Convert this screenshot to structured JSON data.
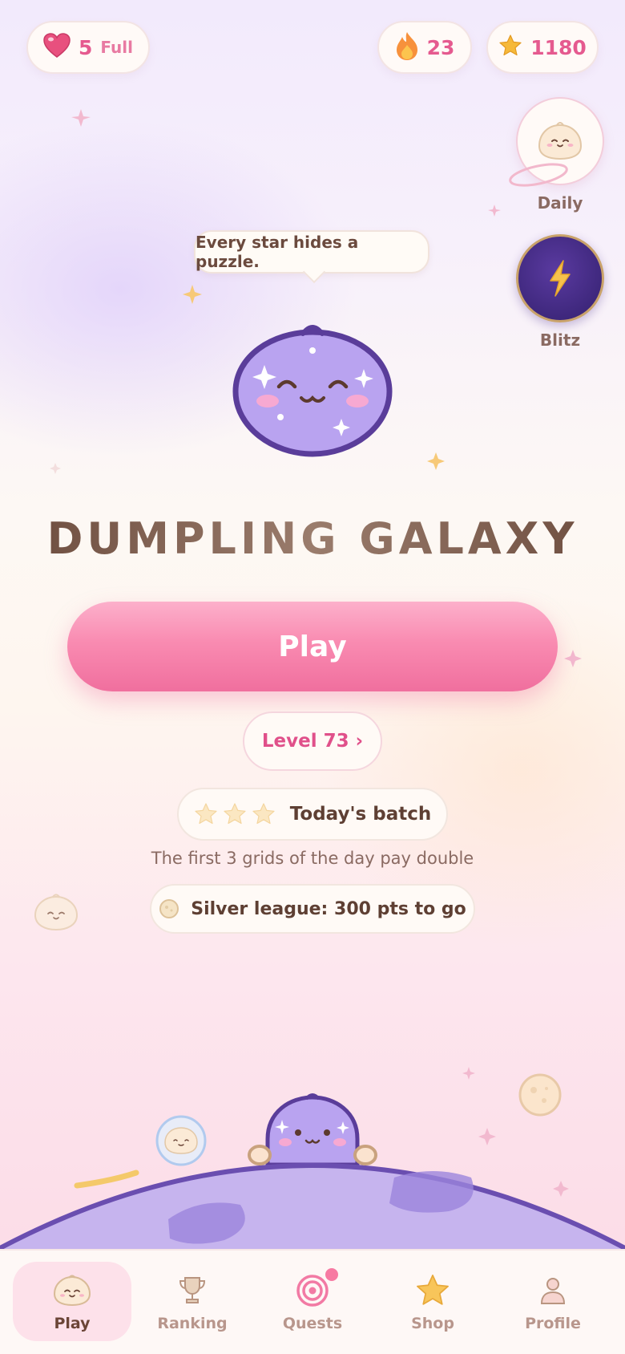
{
  "status_bar": {
    "lives": {
      "count": "5",
      "status": "Full",
      "icon": "heart-icon"
    },
    "streak": {
      "count": "23",
      "icon": "flame-icon"
    },
    "stars": {
      "count": "1180",
      "icon": "star-icon"
    }
  },
  "side_buttons": {
    "daily": {
      "label": "Daily",
      "icon": "dumpling-icon"
    },
    "blitz": {
      "label": "Blitz",
      "icon": "lightning-icon"
    }
  },
  "mascot": {
    "speech": "Every star hides a puzzle."
  },
  "game_title": "DUMPLING GALAXY",
  "play_button": {
    "label": "Play"
  },
  "level_button": {
    "label": "Level 73 ›"
  },
  "daily_batch": {
    "label": "Today's batch",
    "stars_earned": 0,
    "stars_total": 3
  },
  "double_note": "The first 3 grids of the day pay double",
  "league": {
    "label": "Silver league: 300 pts to go",
    "icon": "coin-icon"
  },
  "nav": {
    "active": "play",
    "items": [
      {
        "key": "play",
        "label": "Play",
        "icon": "dumpling-icon"
      },
      {
        "key": "ranking",
        "label": "Ranking",
        "icon": "trophy-icon"
      },
      {
        "key": "quests",
        "label": "Quests",
        "icon": "target-icon",
        "badge": true
      },
      {
        "key": "shop",
        "label": "Shop",
        "icon": "star-icon"
      },
      {
        "key": "profile",
        "label": "Profile",
        "icon": "person-icon"
      }
    ]
  },
  "colors": {
    "accent": "#f06f9e",
    "text_dark": "#5e3f33",
    "mascot": "#b9a3f0",
    "planet": "#c5b3ee",
    "blitz": "#3e2580"
  }
}
